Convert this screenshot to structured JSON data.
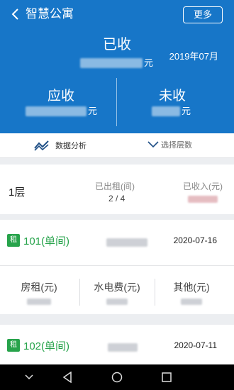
{
  "app": {
    "title": "智慧公寓",
    "more_label": "更多"
  },
  "summary": {
    "received_label": "已收",
    "received_unit": "元",
    "month": "2019年07月",
    "due_label": "应收",
    "due_unit": "元",
    "unpaid_label": "未收",
    "unpaid_unit": "元"
  },
  "actions": {
    "analysis_label": "数据分析",
    "floor_select_label": "选择层数"
  },
  "floor": {
    "name": "1层",
    "rented_header": "已出租(间)",
    "rented_value": "2 / 4",
    "income_header": "已收入(元)"
  },
  "rooms": [
    {
      "badge": "租",
      "name": "101(单间)",
      "date": "2020-07-16"
    },
    {
      "badge": "租",
      "name": "102(单间)",
      "date": "2020-07-11"
    }
  ],
  "fees": {
    "rent_label": "房租(元)",
    "utility_label": "水电费(元)",
    "other_label": "其他(元)"
  },
  "colors": {
    "primary": "#1776c8",
    "accent_green": "#27a34b"
  }
}
